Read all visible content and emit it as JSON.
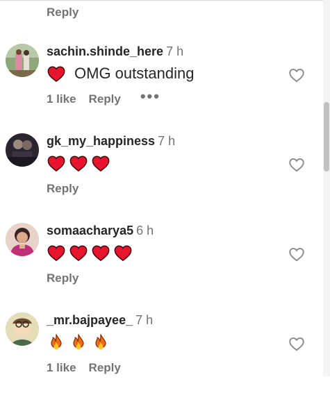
{
  "top_reply_label": "Reply",
  "icons": {
    "like": "heart-outline-icon",
    "more": "more-horizontal-icon"
  },
  "colors": {
    "heart_red": "#e8132c",
    "muted_text": "#737373",
    "primary_text": "#262626"
  },
  "comments": [
    {
      "username": "sachin.shinde_here",
      "time": "7 h",
      "emoji": [
        "red-heart-emoji"
      ],
      "text": "OMG outstanding",
      "likes": "1 like",
      "reply": "Reply",
      "more": "•••"
    },
    {
      "username": "gk_my_happiness",
      "time": "7 h",
      "emoji": [
        "red-heart-emoji",
        "red-heart-emoji",
        "red-heart-emoji"
      ],
      "text": "",
      "likes": "",
      "reply": "Reply"
    },
    {
      "username": "somaacharya5",
      "time": "6 h",
      "emoji": [
        "red-heart-emoji",
        "red-heart-emoji",
        "red-heart-emoji",
        "red-heart-emoji"
      ],
      "text": "",
      "likes": "",
      "reply": "Reply"
    },
    {
      "username": "_mr.bajpayee_",
      "time": "7 h",
      "emoji": [
        "fire-emoji",
        "fire-emoji",
        "fire-emoji"
      ],
      "text": "",
      "likes": "1 like",
      "reply": "Reply"
    }
  ]
}
